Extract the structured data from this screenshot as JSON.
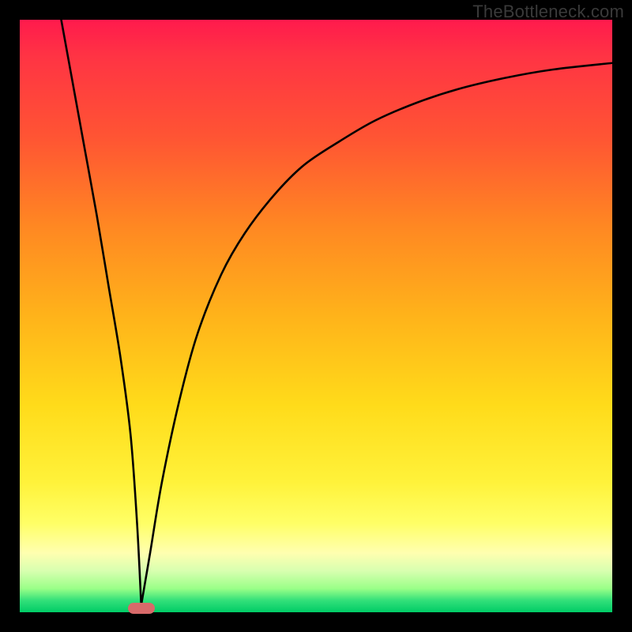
{
  "watermark": "TheBottleneck.com",
  "marker": {
    "color": "#d86a6a",
    "x_frac": 0.205,
    "y_frac": 0.993
  },
  "chart_data": {
    "type": "line",
    "title": "",
    "xlabel": "",
    "ylabel": "",
    "xlim": [
      0,
      100
    ],
    "ylim": [
      0,
      100
    ],
    "grid": false,
    "legend": false,
    "series": [
      {
        "name": "left-descent",
        "x": [
          7,
          9,
          11,
          13,
          15,
          17,
          18.7,
          19.8,
          20.5
        ],
        "y": [
          100,
          89,
          78,
          67,
          55,
          43,
          30,
          15,
          1.2
        ]
      },
      {
        "name": "right-rise",
        "x": [
          20.5,
          22,
          24,
          27,
          30,
          34,
          38,
          43,
          48,
          54,
          60,
          67,
          74,
          82,
          90,
          100
        ],
        "y": [
          1.2,
          10,
          22,
          36,
          47,
          57,
          64,
          70.5,
          75.5,
          79.5,
          83,
          86,
          88.3,
          90.2,
          91.6,
          92.7
        ]
      }
    ],
    "annotations": []
  }
}
